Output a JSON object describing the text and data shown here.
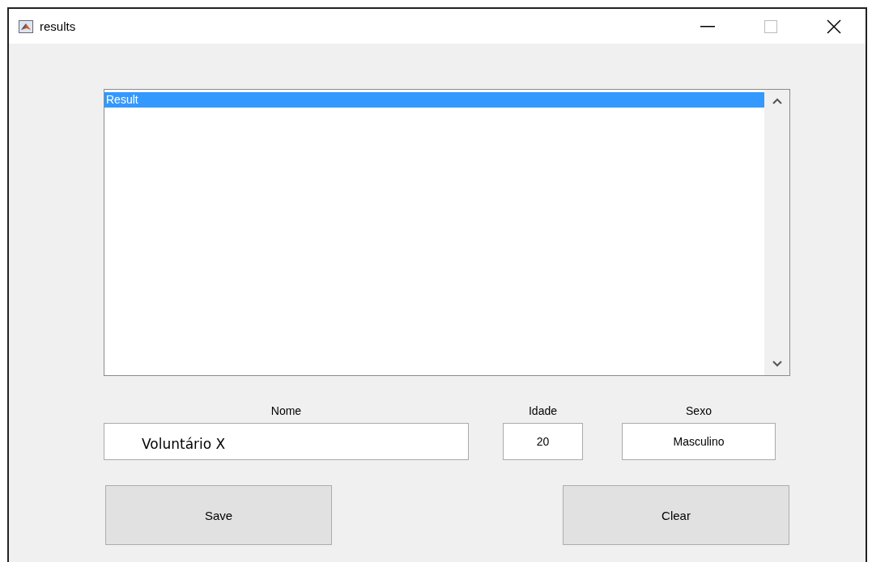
{
  "window": {
    "title": "results"
  },
  "listbox": {
    "items": [
      {
        "text": "Result",
        "selected": true
      }
    ]
  },
  "fields": [
    {
      "label": "Nome",
      "value": "Voluntário X"
    },
    {
      "label": "Idade",
      "value": "20"
    },
    {
      "label": "Sexo",
      "value": "Masculino"
    }
  ],
  "buttons": [
    "Save",
    "Clear"
  ]
}
